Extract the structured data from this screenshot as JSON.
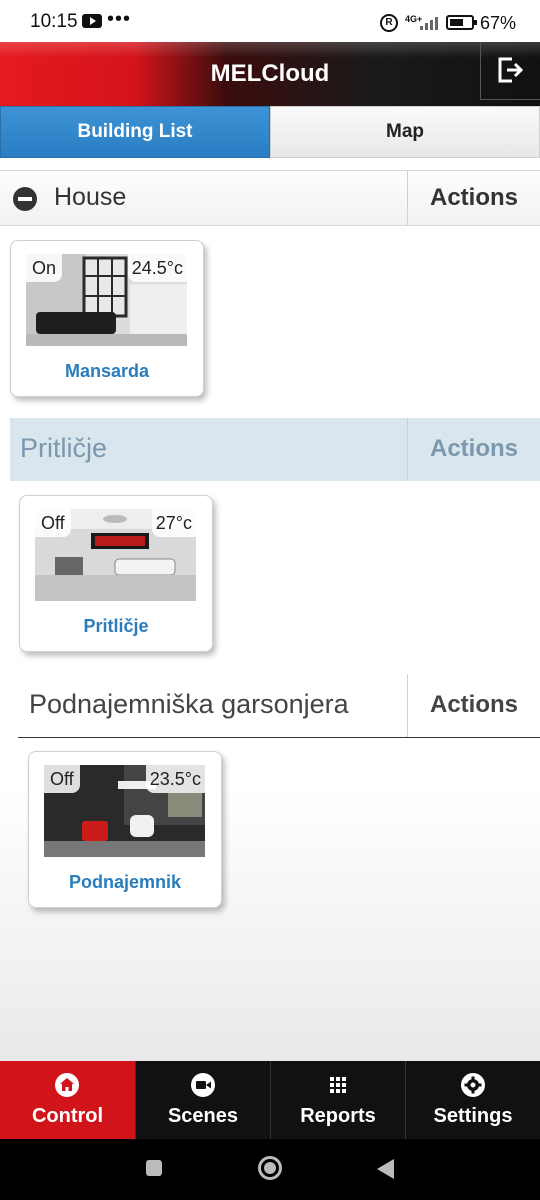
{
  "status_bar": {
    "time": "10:15",
    "dots": "•••",
    "r_badge": "R",
    "network": "4G+",
    "battery_percent": 67,
    "battery_text": "67%"
  },
  "header": {
    "title": "MELCloud",
    "logout_icon": "logout-icon"
  },
  "tabs": {
    "building_list": "Building List",
    "map": "Map"
  },
  "groups": [
    {
      "title": "House",
      "actions": "Actions",
      "devices": [
        {
          "name": "Mansarda",
          "status": "On",
          "temp": "24.5°c"
        }
      ]
    },
    {
      "title": "Pritličje",
      "actions": "Actions",
      "devices": [
        {
          "name": "Pritličje",
          "status": "Off",
          "temp": "27°c"
        }
      ]
    },
    {
      "title": "Podnajemniška garsonjera",
      "actions": "Actions",
      "devices": [
        {
          "name": "Podnajemnik",
          "status": "Off",
          "temp": "23.5°c"
        }
      ]
    }
  ],
  "bottom_nav": {
    "items": [
      {
        "label": "Control",
        "icon": "home-icon"
      },
      {
        "label": "Scenes",
        "icon": "video-icon"
      },
      {
        "label": "Reports",
        "icon": "grid-icon"
      },
      {
        "label": "Settings",
        "icon": "gear-icon"
      }
    ]
  },
  "colors": {
    "brand_red": "#d0141a",
    "tab_blue": "#2a7dc2",
    "link_blue": "#2a7dbd"
  }
}
